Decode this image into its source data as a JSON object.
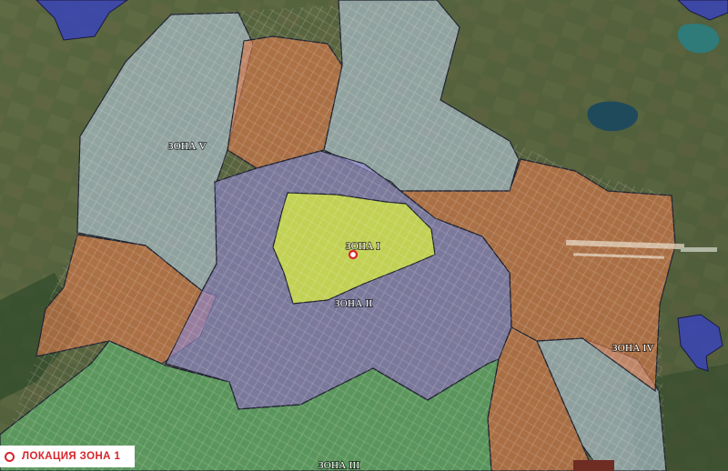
{
  "map": {
    "colors": {
      "zone_1": "#d9ef3c",
      "zone_2": "#8e85c9",
      "zone_3": "#5fb871",
      "zone_4": "#d9784a",
      "zone_5": "#b4c9dc",
      "outer_settlements": "#3a44b8",
      "location_marker": "#d8242a"
    },
    "labels": {
      "zone_1": "ЗОНА I",
      "zone_2": "ЗОНА II",
      "zone_3": "ЗОНА III",
      "zone_4": "ЗОНА IV",
      "zone_5": "ЗОНА V"
    }
  },
  "legend": {
    "marker_icon": "location-dot-icon",
    "label": "ЛОКАЦИЯ  ЗОНА 1"
  }
}
